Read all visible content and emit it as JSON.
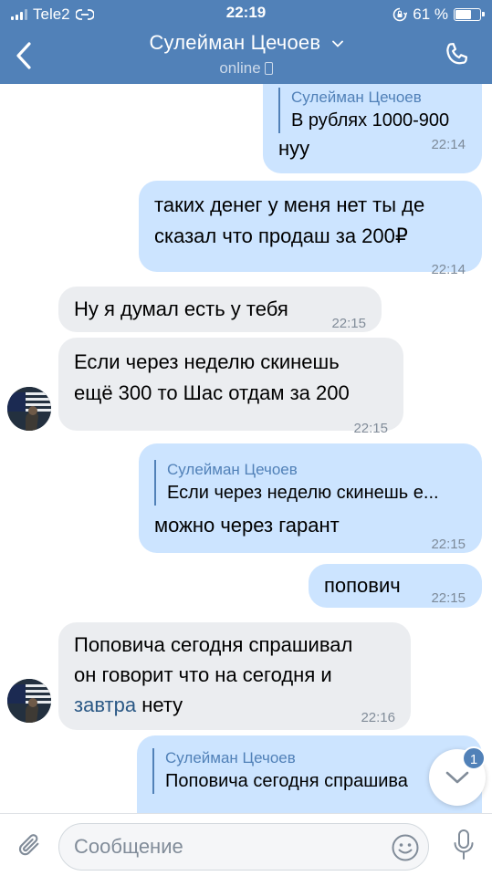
{
  "status_bar": {
    "carrier": "Tele2",
    "time": "22:19",
    "battery": "61 %",
    "battery_level": 0.61
  },
  "header": {
    "name": "Сулейман Цечоев",
    "status": "online",
    "accent": "#5181b8"
  },
  "messages": [
    {
      "direction": "out",
      "reply_author": "Сулейман Цечоев",
      "reply_text": "В рублях 1000-900",
      "text": "нуу",
      "time": "22:14"
    },
    {
      "direction": "out",
      "line1": "таких денег у меня нет ты де",
      "line2": "сказал что продаш за 200₽",
      "time": "22:14"
    },
    {
      "direction": "in",
      "text": "Ну я думал есть у тебя",
      "time": "22:15"
    },
    {
      "direction": "in",
      "line1": "Если через неделю скинешь",
      "line2": "ещё 300 то Шас отдам за 200",
      "time": "22:15"
    },
    {
      "direction": "out",
      "reply_author": "Сулейман Цечоев",
      "reply_text": "Если через неделю скинешь е...",
      "text": "можно через гарант",
      "time": "22:15"
    },
    {
      "direction": "out",
      "text": "попович",
      "time": "22:15"
    },
    {
      "direction": "in",
      "line1": "Поповича сегодня спрашивал",
      "line2": "он говорит что на сегодня и",
      "link": "завтра",
      "line3_rest": " нету",
      "time": "22:16"
    },
    {
      "direction": "out",
      "reply_author": "Сулейман Цечоев",
      "reply_text": "Поповича сегодня спрашива"
    }
  ],
  "scroll_down": {
    "badge_count": "1"
  },
  "composer": {
    "placeholder": "Сообщение"
  },
  "icons": {
    "back": "back-arrow-icon",
    "call": "phone-icon",
    "attach": "paperclip-icon",
    "emoji": "smile-icon",
    "mic": "microphone-icon",
    "scroll": "chevron-down-icon"
  }
}
